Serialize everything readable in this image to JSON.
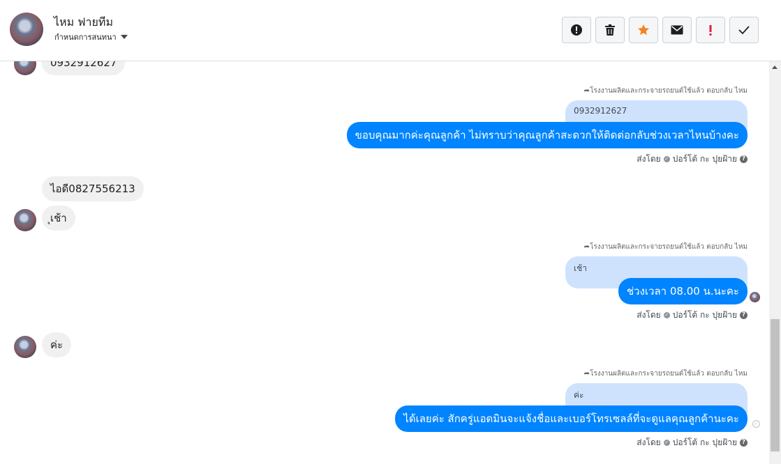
{
  "header": {
    "contact_name": "ไหม ฟายทีม",
    "assign_label": "กำหนดการสนทนา",
    "actions": [
      {
        "name": "spam-button",
        "icon": "alert-circle-icon"
      },
      {
        "name": "delete-button",
        "icon": "trash-icon"
      },
      {
        "name": "star-button",
        "icon": "star-icon"
      },
      {
        "name": "mark-unread-button",
        "icon": "envelope-icon"
      },
      {
        "name": "important-button",
        "icon": "exclamation-icon"
      },
      {
        "name": "done-button",
        "icon": "check-icon"
      }
    ]
  },
  "messages": {
    "incoming_1": "0932912627",
    "reply_1": {
      "label": "โรงงานผลิตและกระจายรถยนต์ใช้แล้ว ตอบกลับ ไหม",
      "quote": "0932912627",
      "text": "ขอบคุณมากค่ะคุณลูกค้า ไม่ทราบว่าคุณลูกค้าสะดวกให้ติดต่อกลับช่วงเวลาไหนบ้างคะ",
      "sent_by": "ส่งโดย",
      "sender": "ปอร์โต้ กะ ปุยฝ้าย"
    },
    "incoming_2": "ไอดี0827556213",
    "incoming_3": "ุเช้า",
    "reply_2": {
      "label": "โรงงานผลิตและกระจายรถยนต์ใช้แล้ว ตอบกลับ ไหม",
      "quote": "เช้า",
      "text": "ช่วงเวลา 08.00 น.นะคะ",
      "sent_by": "ส่งโดย",
      "sender": "ปอร์โต้ กะ ปุยฝ้าย"
    },
    "incoming_4": "ค่ะ",
    "reply_3": {
      "label": "โรงงานผลิตและกระจายรถยนต์ใช้แล้ว ตอบกลับ ไหม",
      "quote": "ค่ะ",
      "text": "ได้เลยค่ะ สักครู่แอดมินจะแจ้งชื่อและเบอร์โทรเซลล์ที่จะดูแลคุณลูกค้านะคะ",
      "sent_by": "ส่งโดย",
      "sender": "ปอร์โต้ กะ ปุยฝ้าย"
    }
  },
  "colors": {
    "outgoing_bubble": "#0084ff",
    "quote_bubble": "#cfe2fd",
    "incoming_bubble": "#f0f0f0",
    "star": "#f5821f",
    "important": "#e41e3f"
  }
}
